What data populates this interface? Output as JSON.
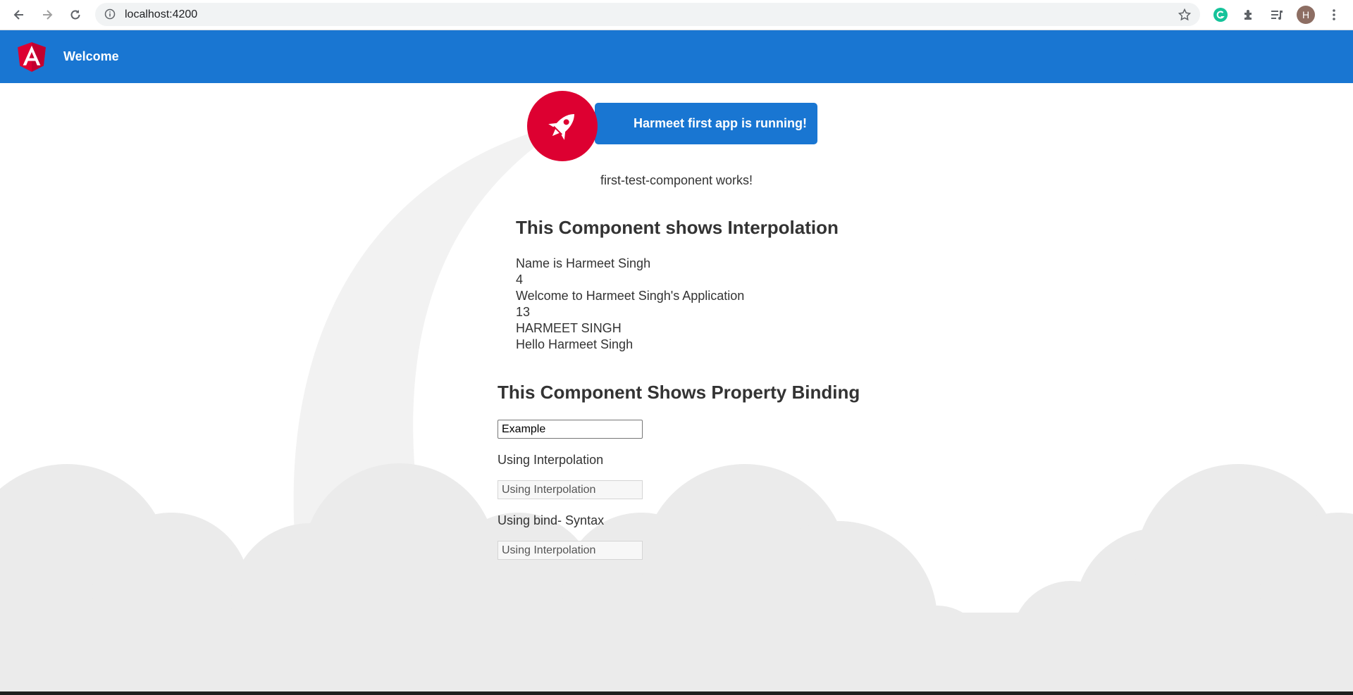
{
  "browser": {
    "url": "localhost:4200",
    "avatar_letter": "H",
    "icons": [
      "back-icon",
      "forward-icon",
      "reload-icon",
      "info-icon",
      "star-icon",
      "grammarly-icon",
      "extensions-icon",
      "reading-list-icon"
    ]
  },
  "toolbar": {
    "title": "Welcome",
    "color": "#1976d2"
  },
  "hero": {
    "running_text": "Harmeet first app is running!",
    "accent": "#dd0031"
  },
  "component_status": "first-test-component works!",
  "interpolation": {
    "heading": "This Component shows Interpolation",
    "lines": [
      "Name is Harmeet Singh",
      "4",
      "Welcome to Harmeet Singh's Application",
      "13",
      "HARMEET SINGH",
      "Hello Harmeet Singh"
    ]
  },
  "property_binding": {
    "heading": "This Component Shows Property Binding",
    "input_1_value": "Example",
    "label_1": "Using Interpolation",
    "input_2_value": "Using Interpolation",
    "label_2": "Using bind- Syntax",
    "input_3_value": "Using Interpolation"
  }
}
